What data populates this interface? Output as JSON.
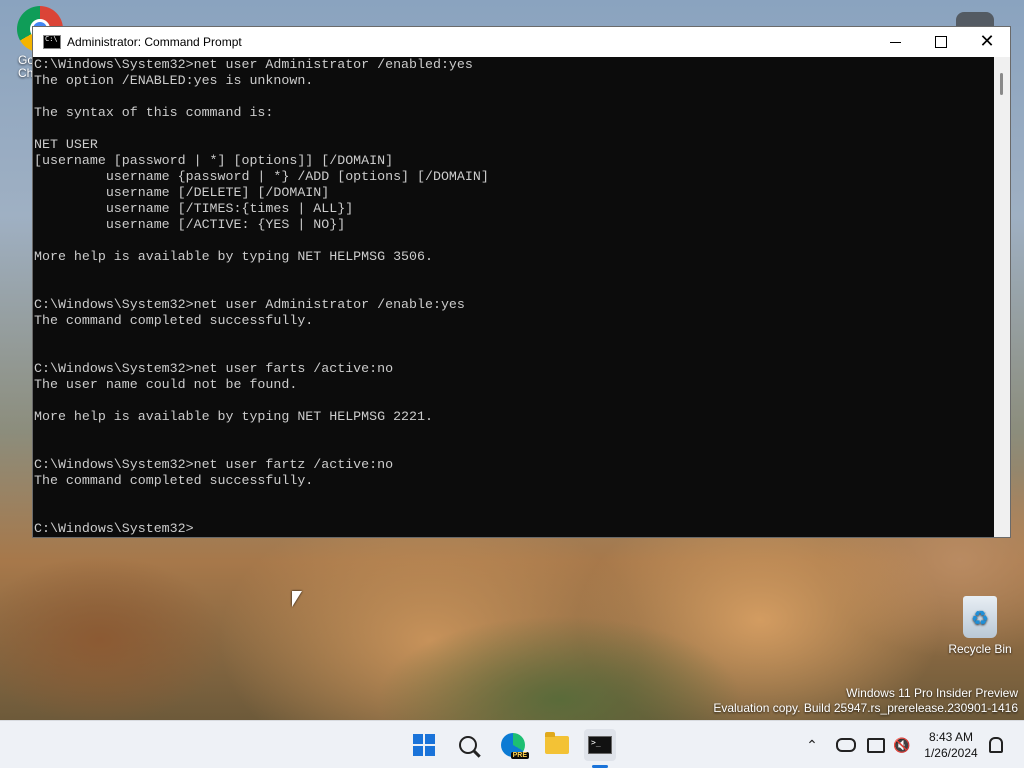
{
  "desktop": {
    "icons": {
      "chrome_label_line1": "Go",
      "chrome_label_line2": "Ch",
      "recycle_bin_label": "Recycle Bin"
    },
    "watermark": {
      "line1": "Windows 11 Pro Insider Preview",
      "line2": "Evaluation copy. Build 25947.rs_prerelease.230901-1416"
    }
  },
  "window": {
    "title": "Administrator: Command Prompt",
    "minimize_icon": "minimize-icon",
    "maximize_icon": "maximize-icon",
    "close_icon": "close-icon",
    "console_lines": [
      "C:\\Windows\\System32>net user Administrator /enabled:yes",
      "The option /ENABLED:yes is unknown.",
      "",
      "The syntax of this command is:",
      "",
      "NET USER",
      "[username [password | *] [options]] [/DOMAIN]",
      "         username {password | *} /ADD [options] [/DOMAIN]",
      "         username [/DELETE] [/DOMAIN]",
      "         username [/TIMES:{times | ALL}]",
      "         username [/ACTIVE: {YES | NO}]",
      "",
      "More help is available by typing NET HELPMSG 3506.",
      "",
      "",
      "C:\\Windows\\System32>net user Administrator /enable:yes",
      "The command completed successfully.",
      "",
      "",
      "C:\\Windows\\System32>net user farts /active:no",
      "The user name could not be found.",
      "",
      "More help is available by typing NET HELPMSG 2221.",
      "",
      "",
      "C:\\Windows\\System32>net user fartz /active:no",
      "The command completed successfully.",
      "",
      "",
      "C:\\Windows\\System32>"
    ]
  },
  "taskbar": {
    "apps": [
      "start-icon",
      "search-icon",
      "edge-icon",
      "file-explorer-icon",
      "command-prompt-icon"
    ],
    "edge_badge": "PRE",
    "clock": {
      "time": "8:43 AM",
      "date": "1/26/2024"
    },
    "tray_icons": [
      "chevron-up-icon",
      "onedrive-icon",
      "network-icon",
      "volume-muted-icon",
      "notification-bell-icon"
    ]
  },
  "colors": {
    "console_bg": "#0c0c0c",
    "console_text": "#cccccc",
    "accent": "#1a73d9"
  }
}
